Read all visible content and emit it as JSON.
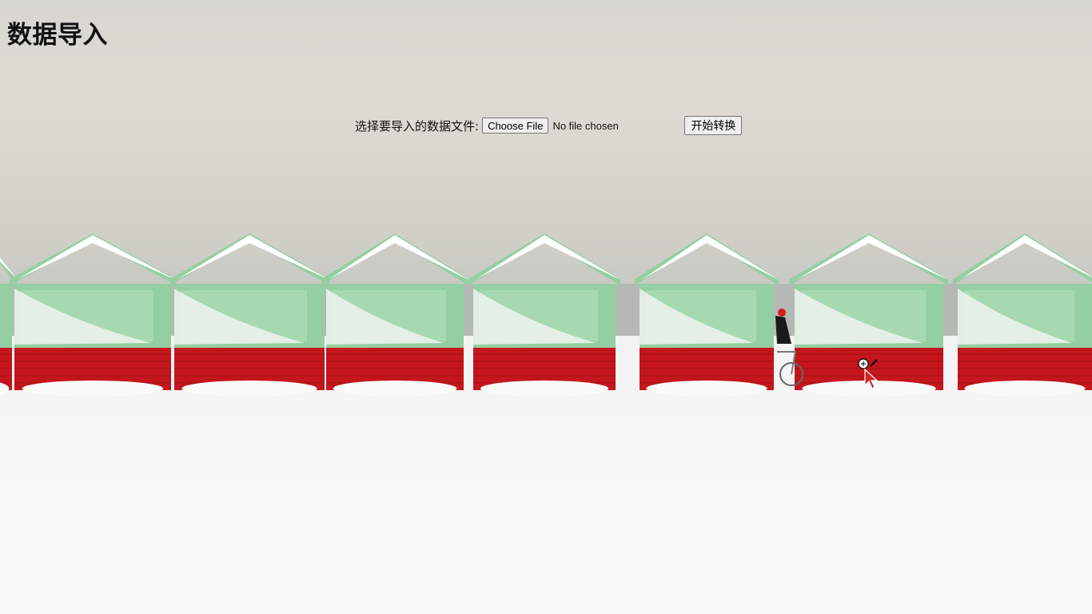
{
  "page": {
    "title": "数据导入"
  },
  "form": {
    "file_label": "选择要导入的数据文件:",
    "file_button_label": "Choose File",
    "file_status": "No file chosen",
    "submit_label": "开始转换"
  },
  "colors": {
    "hut_green": "#93cfa2",
    "hut_red": "#c4161c",
    "sky": "#d9d9d2",
    "snow": "#f6f6f6"
  }
}
